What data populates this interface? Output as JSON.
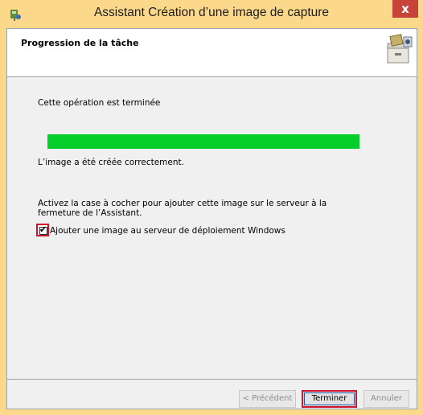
{
  "window": {
    "title": "Assistant Création d’une image de capture",
    "close_glyph": "x"
  },
  "header": {
    "title": "Progression de la tâche",
    "icon": "cabinet-icon"
  },
  "content": {
    "status": "Cette opération est terminée",
    "progress_fraction": 1.0,
    "result": "L’image a été créée correctement.",
    "instruction": "Activez la case à cocher pour ajouter cette image sur le serveur à la fermeture de l’Assistant.",
    "checkbox_label": "Ajouter une image au serveur de déploiement Windows",
    "checkbox_checked": true
  },
  "buttons": {
    "previous": "< Précédent",
    "finish": "Terminer",
    "cancel": "Annuler"
  },
  "colors": {
    "titlebar": "#fbd88a",
    "progress": "#06cf2a",
    "highlight": "#d0142c"
  }
}
